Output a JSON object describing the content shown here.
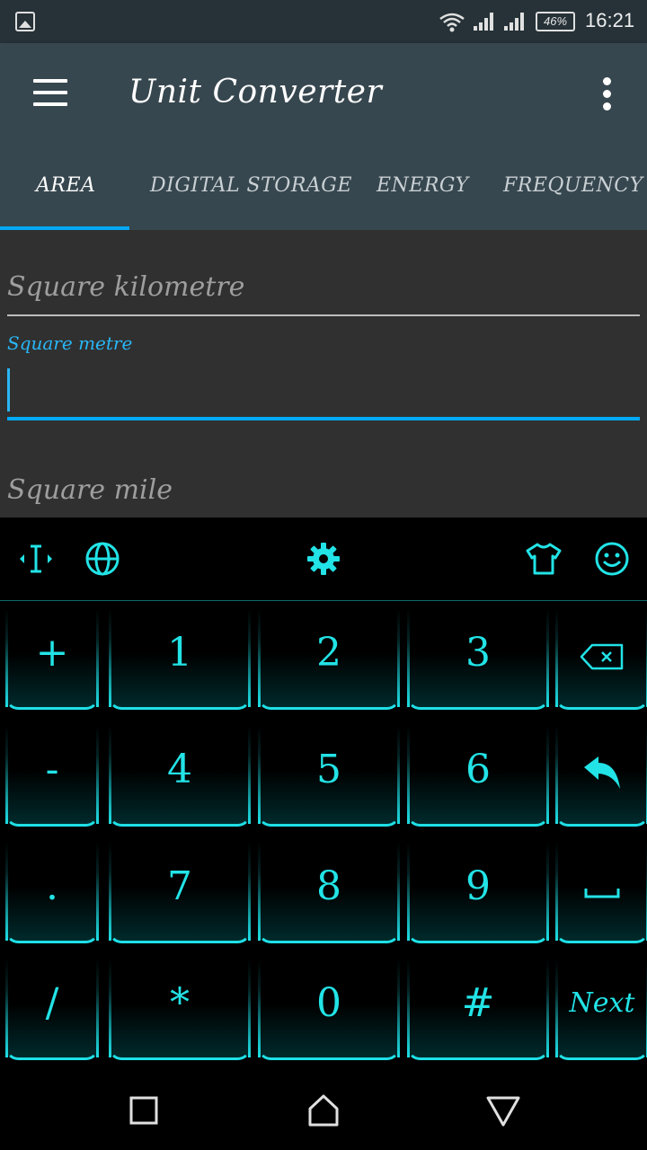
{
  "status_bar": {
    "battery": "46%",
    "time": "16:21",
    "icons": [
      "gallery-icon",
      "wifi-icon",
      "signal-icon",
      "signal-icon",
      "battery-icon"
    ]
  },
  "app_bar": {
    "title": "Unit Converter",
    "menu_icon": "menu-icon",
    "overflow_icon": "more-vert-icon"
  },
  "tabs": [
    {
      "label": "AREA",
      "active": true
    },
    {
      "label": "DIGITAL STORAGE",
      "active": false
    },
    {
      "label": "ENERGY",
      "active": false
    },
    {
      "label": "FREQUENCY",
      "active": false
    }
  ],
  "fields": {
    "square_kilometre": {
      "placeholder": "Square kilometre",
      "value": ""
    },
    "square_metre": {
      "label": "Square metre",
      "value": ""
    },
    "square_mile": {
      "placeholder": "Square mile",
      "value": ""
    }
  },
  "keyboard": {
    "toolbar_icons": [
      "cursor-move-icon",
      "globe-icon",
      "settings-gear-icon",
      "theme-shirt-icon",
      "emoji-smile-icon"
    ],
    "accent_color": "#1ee0e6",
    "rows": [
      [
        "+",
        "1",
        "2",
        "3",
        "backspace-icon"
      ],
      [
        "-",
        "4",
        "5",
        "6",
        "enter-icon"
      ],
      [
        ".",
        "7",
        "8",
        "9",
        "space-icon"
      ],
      [
        "/",
        "*",
        "0",
        "#",
        "Next"
      ]
    ]
  },
  "nav_bar": {
    "icons": [
      "recents-square-icon",
      "home-icon",
      "back-triangle-icon"
    ]
  },
  "colors": {
    "app_bar": "#37474f",
    "status_bar": "#263238",
    "content_bg": "#303030",
    "accent": "#03a9f4"
  }
}
